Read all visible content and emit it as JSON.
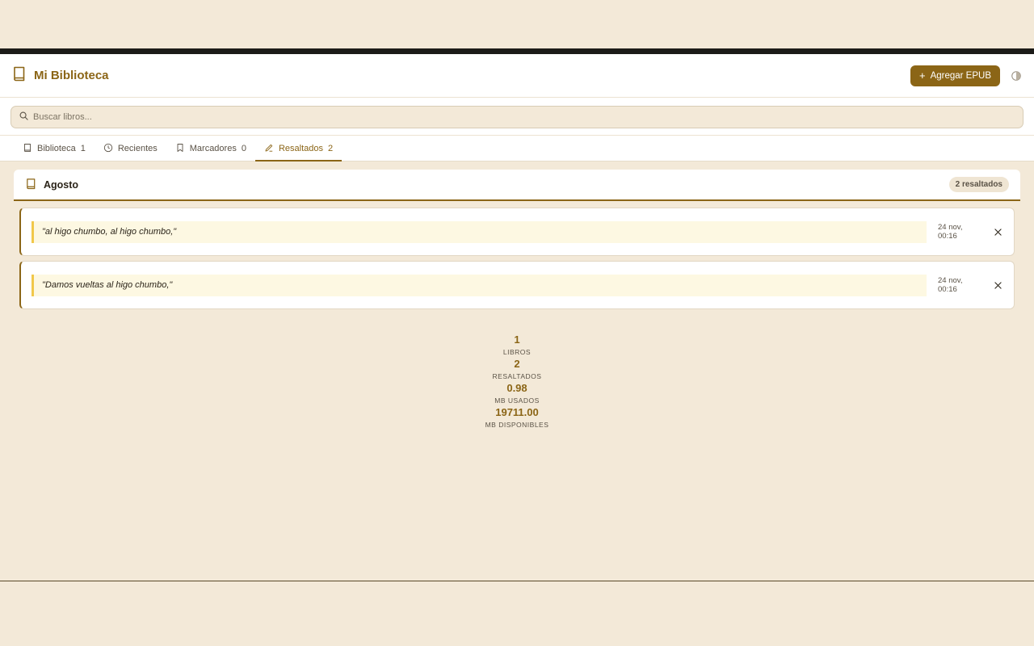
{
  "header": {
    "title": "Mi Biblioteca",
    "add_button_label": "Agregar EPUB",
    "accent_color": "#8b6516"
  },
  "search": {
    "placeholder": "Buscar libros..."
  },
  "tabs": [
    {
      "label": "Biblioteca",
      "count": "1",
      "icon": "book-icon",
      "active": false
    },
    {
      "label": "Recientes",
      "count": "",
      "icon": "clock-icon",
      "active": false
    },
    {
      "label": "Marcadores",
      "count": "0",
      "icon": "bookmark-icon",
      "active": false
    },
    {
      "label": "Resaltados",
      "count": "2",
      "icon": "pencil-icon",
      "active": true
    }
  ],
  "book": {
    "title": "Agosto",
    "badge": "2 resaltados"
  },
  "highlights": [
    {
      "text": "\"al higo chumbo, al higo chumbo,\"",
      "date": "24 nov, 00:16"
    },
    {
      "text": "\"Damos vueltas al higo chumbo,\"",
      "date": "24 nov, 00:16"
    }
  ],
  "stats": [
    {
      "value": "1",
      "label": "LIBROS"
    },
    {
      "value": "2",
      "label": "RESALTADOS"
    },
    {
      "value": "0.98",
      "label": "MB USADOS"
    },
    {
      "value": "19711.00",
      "label": "MB DISPONIBLES"
    }
  ]
}
